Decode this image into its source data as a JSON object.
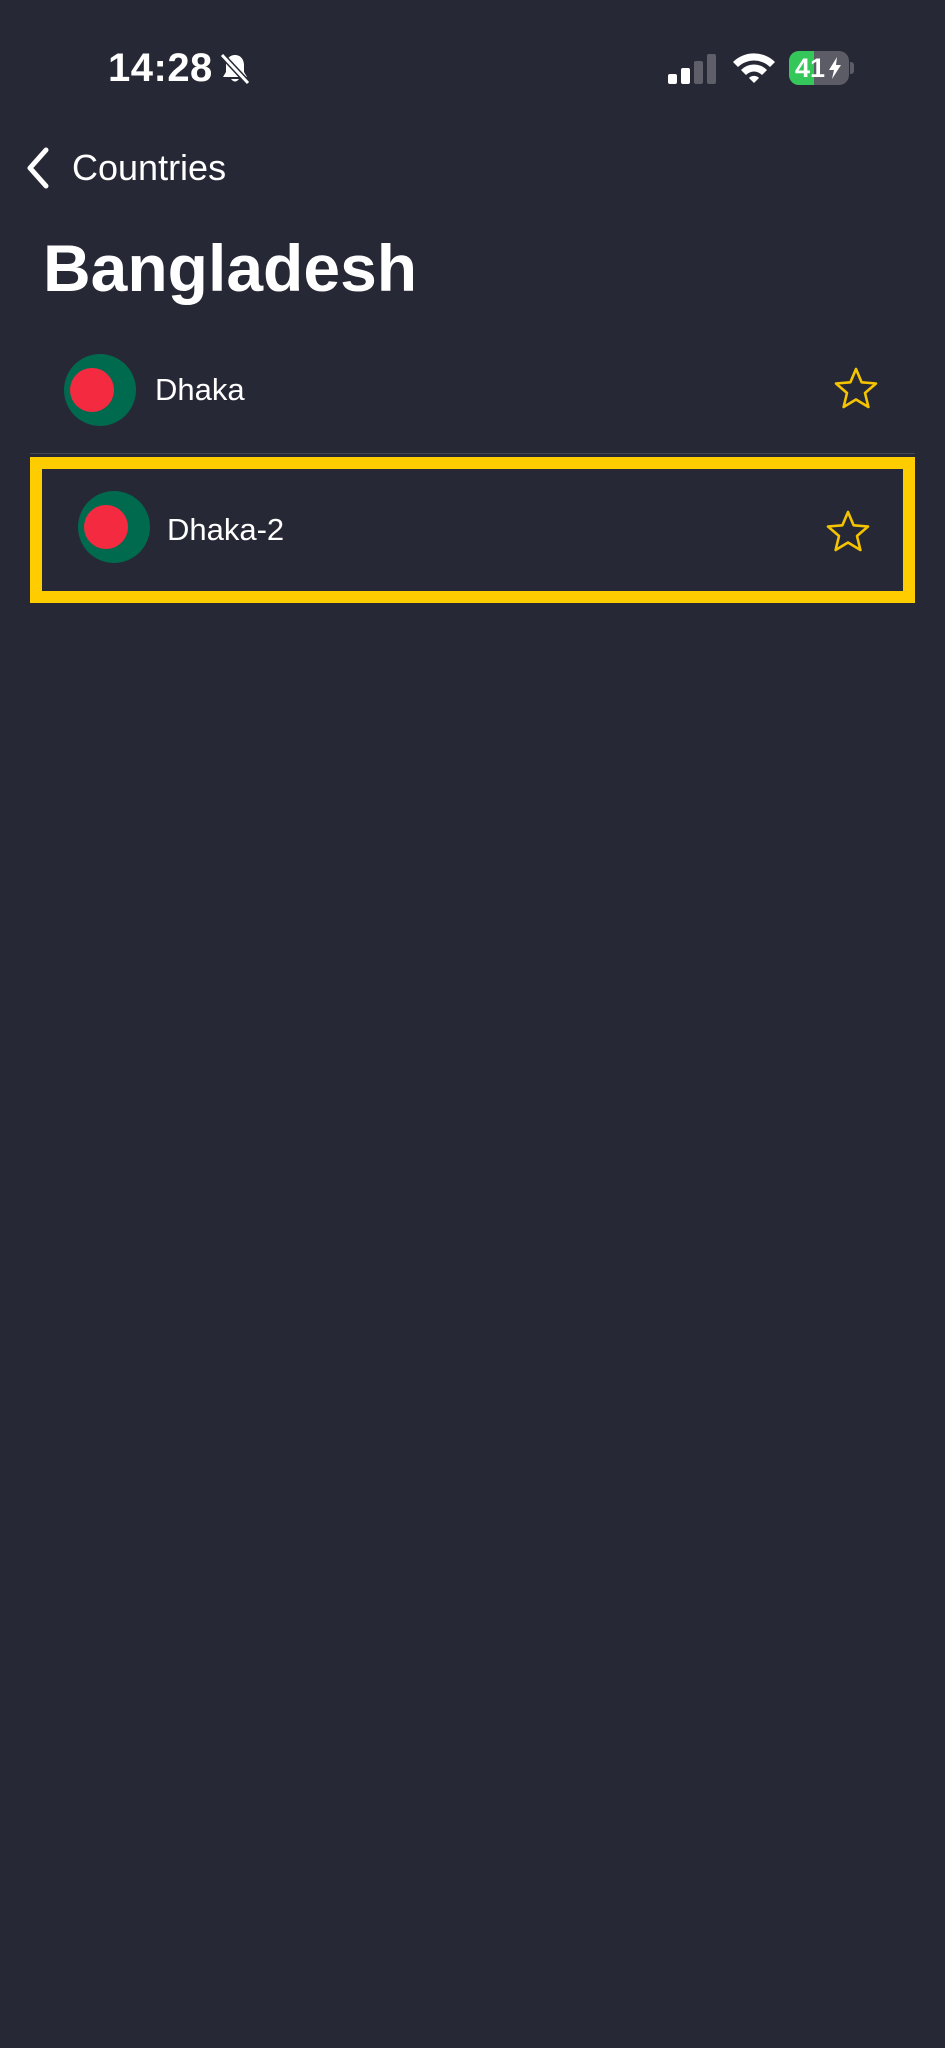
{
  "status_bar": {
    "time": "14:28",
    "battery_level": "41",
    "battery_fraction": 0.41,
    "icons": [
      "bell-slash-icon",
      "cellular-signal-icon",
      "wifi-icon",
      "battery-charging-icon"
    ]
  },
  "nav": {
    "back_label": "Countries",
    "back_icon": "chevron-left-icon"
  },
  "page": {
    "title": "Bangladesh"
  },
  "servers": [
    {
      "name": "Dhaka",
      "flag": "bangladesh-flag-icon",
      "favorite_icon": "star-outline-icon",
      "highlighted": false
    },
    {
      "name": "Dhaka-2",
      "flag": "bangladesh-flag-icon",
      "favorite_icon": "star-outline-icon",
      "highlighted": true
    }
  ],
  "colors": {
    "background": "#272835",
    "text": "#ffffff",
    "star": "#f5c400",
    "highlight": "#ffcc00",
    "flag_green": "#006a4e",
    "flag_red": "#f42a41",
    "battery_green": "#34c759"
  }
}
